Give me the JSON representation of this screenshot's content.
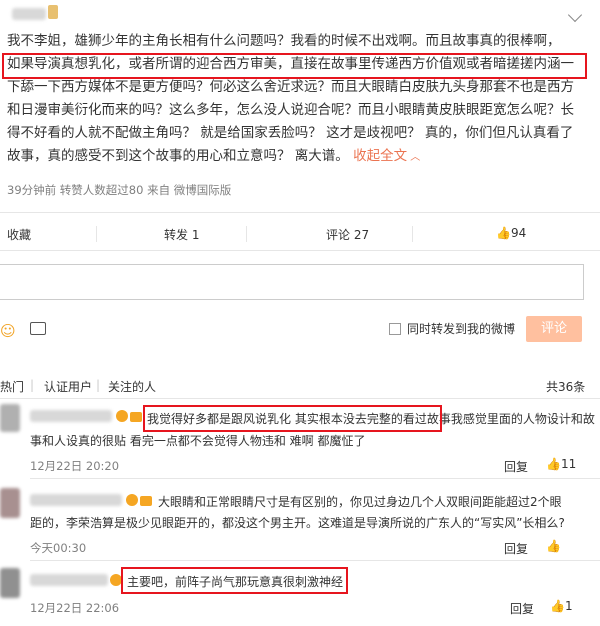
{
  "post": {
    "line1": "我不李姐，雄狮少年的主角长相有什么问题吗？我看的时候不出戏啊。而且故事真的很棒啊，",
    "line2": "如果导演真想乳化，或者所谓的迎合西方审美，直接在故事里传递西方价值观或者暗搓搓内涵一",
    "line3": "下舔一下西方媒体不是更方便吗？何必这么舍近求远？而且大眼睛白皮肤九头身那套不也是西方",
    "line4": "和日漫审美衍化而来的吗？这么多年，怎么没人说迎合呢？而且小眼睛黄皮肤眼距宽怎么呢？长",
    "line5": "得不好看的人就不配做主角吗？ 就是给国家丢脸吗？ 这才是歧视吧？ 真的，你们但凡认真看了",
    "line6a": "故事，真的感受不到这个故事的用心和立意吗？ 离大谱。 ",
    "collapse": "收起全文",
    "meta": "39分钟前 转赞人数超过80  来自 微博国际版"
  },
  "actions": {
    "collect": "收藏",
    "repost": "转发 1",
    "comment": "评论 27",
    "like_count": "94"
  },
  "composer": {
    "sync_label": "同时转发到我的微博",
    "submit": "评论"
  },
  "tabs": {
    "hot": "热门",
    "verified": "认证用户",
    "following": "关注的人",
    "total": "共36条"
  },
  "comments": [
    {
      "line1_boxed": "我觉得好多都是跟风说乳化 其实根本没去完整的看过故事",
      "line1_rest": "我感觉里面的人物设计和故",
      "line2": "事和人设真的很贴 看完一点都不会觉得人物违和 难啊 都魔怔了",
      "time": "12月22日 20:20",
      "reply": "回复",
      "likes": "11"
    },
    {
      "line1": "大眼睛和正常眼睛尺寸是有区别的，你见过身边几个人双眼间距能超过2个眼",
      "line2": "距的，李荣浩算是极少见眼距开的，都没这个男主开。这难道是导演所说的广东人的“写实风”长相么?",
      "time": "今天00:30",
      "reply": "回复",
      "likes": ""
    },
    {
      "line1_boxed": "主要吧，前阵子尚气那玩意真很刺激神经",
      "time": "12月22日 22:06",
      "reply": "回复",
      "likes": "1"
    }
  ]
}
